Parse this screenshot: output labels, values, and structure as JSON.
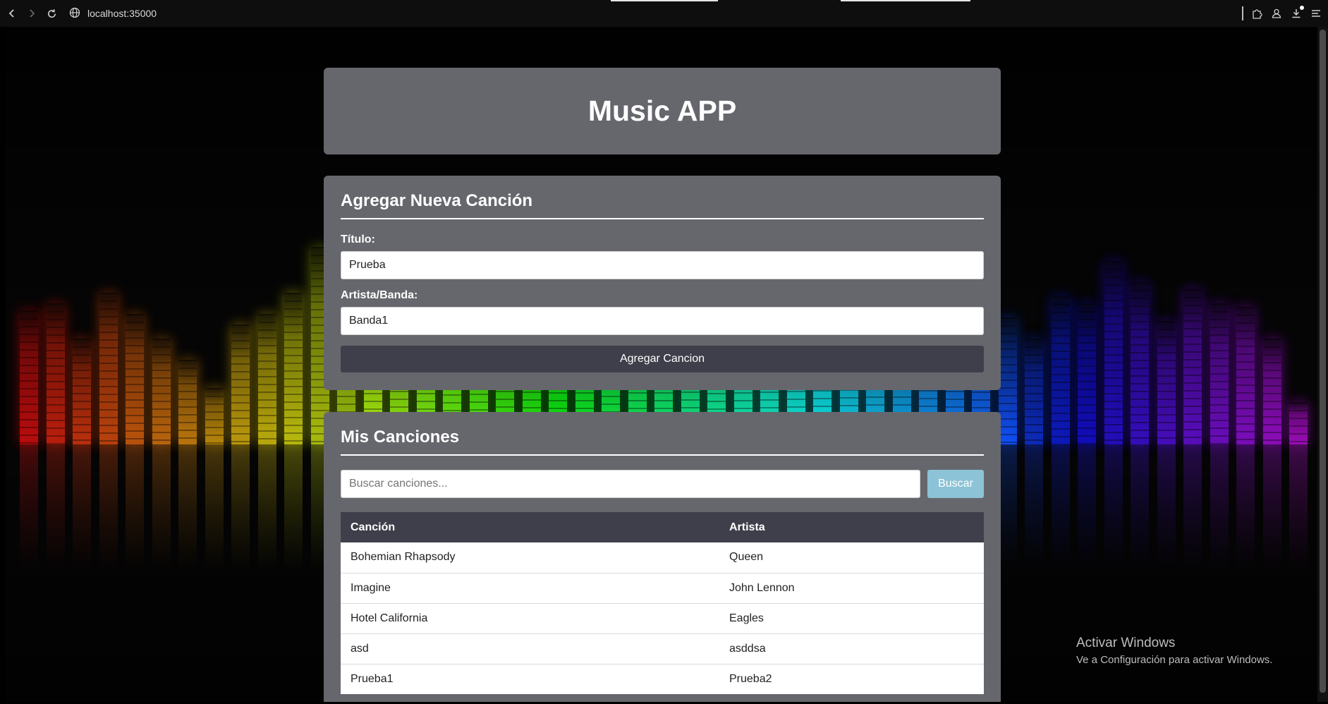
{
  "browser": {
    "url": "localhost:35000",
    "back_icon": "chevron-left-icon",
    "forward_icon": "chevron-right-icon",
    "reload_icon": "reload-icon",
    "site_icon": "globe-icon"
  },
  "header": {
    "title": "Music APP"
  },
  "form": {
    "title": "Agregar Nueva Canción",
    "title_label": "Título:",
    "title_value": "Prueba",
    "artist_label": "Artista/Banda:",
    "artist_value": "Banda1",
    "submit_label": "Agregar Cancion"
  },
  "list": {
    "title": "Mis Canciones",
    "search_placeholder": "Buscar canciones...",
    "search_button": "Buscar",
    "columns": [
      "Canción",
      "Artista"
    ],
    "rows": [
      [
        "Bohemian Rhapsody",
        "Queen"
      ],
      [
        "Imagine",
        "John Lennon"
      ],
      [
        "Hotel California",
        "Eagles"
      ],
      [
        "asd",
        "asddsa"
      ],
      [
        "Prueba1",
        "Prueba2"
      ]
    ]
  },
  "watermark": {
    "title": "Activar Windows",
    "subtitle": "Ve a Configuración para activar Windows."
  },
  "colors": {
    "panel": "#66676d",
    "dark_button": "#3f3f4b",
    "search_button": "#8cc3d6"
  }
}
